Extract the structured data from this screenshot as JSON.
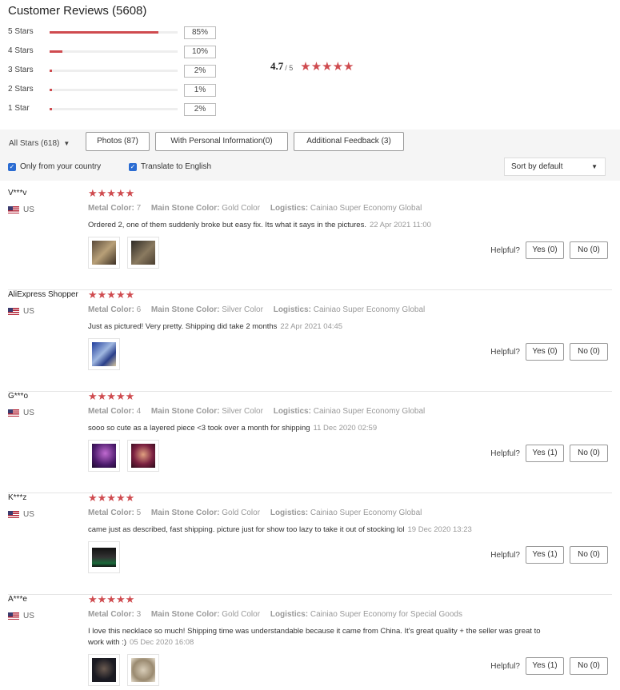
{
  "header": {
    "title": "Customer Reviews (5608)"
  },
  "ratings": [
    {
      "label": "5 Stars",
      "percent": "85%",
      "fill": 0.85
    },
    {
      "label": "4 Stars",
      "percent": "10%",
      "fill": 0.1
    },
    {
      "label": "3 Stars",
      "percent": "2%",
      "fill": 0.02
    },
    {
      "label": "2 Stars",
      "percent": "1%",
      "fill": 0.01
    },
    {
      "label": "1 Star",
      "percent": "2%",
      "fill": 0.02
    }
  ],
  "average": {
    "score": "4.7",
    "out_of": "/ 5",
    "stars": "★★★★★"
  },
  "filters": {
    "all_stars": "All Stars (618)",
    "photos": "Photos (87)",
    "personal_info": "With Personal Information(0)",
    "additional": "Additional Feedback (3)",
    "only_country": "Only from your country",
    "translate": "Translate to English",
    "sort": "Sort by default"
  },
  "labels": {
    "metal_color": "Metal Color:",
    "main_stone_color": "Main Stone Color:",
    "logistics": "Logistics:",
    "helpful": "Helpful?"
  },
  "reviews": [
    {
      "name": "V***v",
      "country": "US",
      "stars": "★★★★★",
      "metal": "7",
      "stone": "Gold Color",
      "logistics": "Cainiao Super Economy Global",
      "text": "Ordered 2, one of them suddenly broke but easy fix. Its what it says in the pictures.",
      "date": "22 Apr 2021 11:00",
      "yes": "Yes (0)",
      "no": "No (0)"
    },
    {
      "name": "AliExpress Shopper",
      "country": "US",
      "stars": "★★★★★",
      "metal": "6",
      "stone": "Silver Color",
      "logistics": "Cainiao Super Economy Global",
      "text": "Just as pictured! Very pretty. Shipping did take 2 months",
      "date": "22 Apr 2021 04:45",
      "yes": "Yes (0)",
      "no": "No (0)"
    },
    {
      "name": "G***o",
      "country": "US",
      "stars": "★★★★★",
      "metal": "4",
      "stone": "Silver Color",
      "logistics": "Cainiao Super Economy Global",
      "text": "sooo so cute as a layered piece <3 took over a month for shipping",
      "date": "11 Dec 2020 02:59",
      "yes": "Yes (1)",
      "no": "No (0)"
    },
    {
      "name": "K***z",
      "country": "US",
      "stars": "★★★★★",
      "metal": "5",
      "stone": "Gold Color",
      "logistics": "Cainiao Super Economy Global",
      "text": "came just as described, fast shipping. picture just for show too lazy to take it out of stocking lol",
      "date": "19 Dec 2020 13:23",
      "yes": "Yes (1)",
      "no": "No (0)"
    },
    {
      "name": "A***e",
      "country": "US",
      "stars": "★★★★★",
      "metal": "3",
      "stone": "Gold Color",
      "logistics": "Cainiao Super Economy for Special Goods",
      "text": "I love this necklace so much! Shipping time was understandable because it came from China. It's great quality + the seller was great to work with :)",
      "date": "05 Dec 2020 16:08",
      "yes": "Yes (1)",
      "no": "No (0)"
    }
  ]
}
